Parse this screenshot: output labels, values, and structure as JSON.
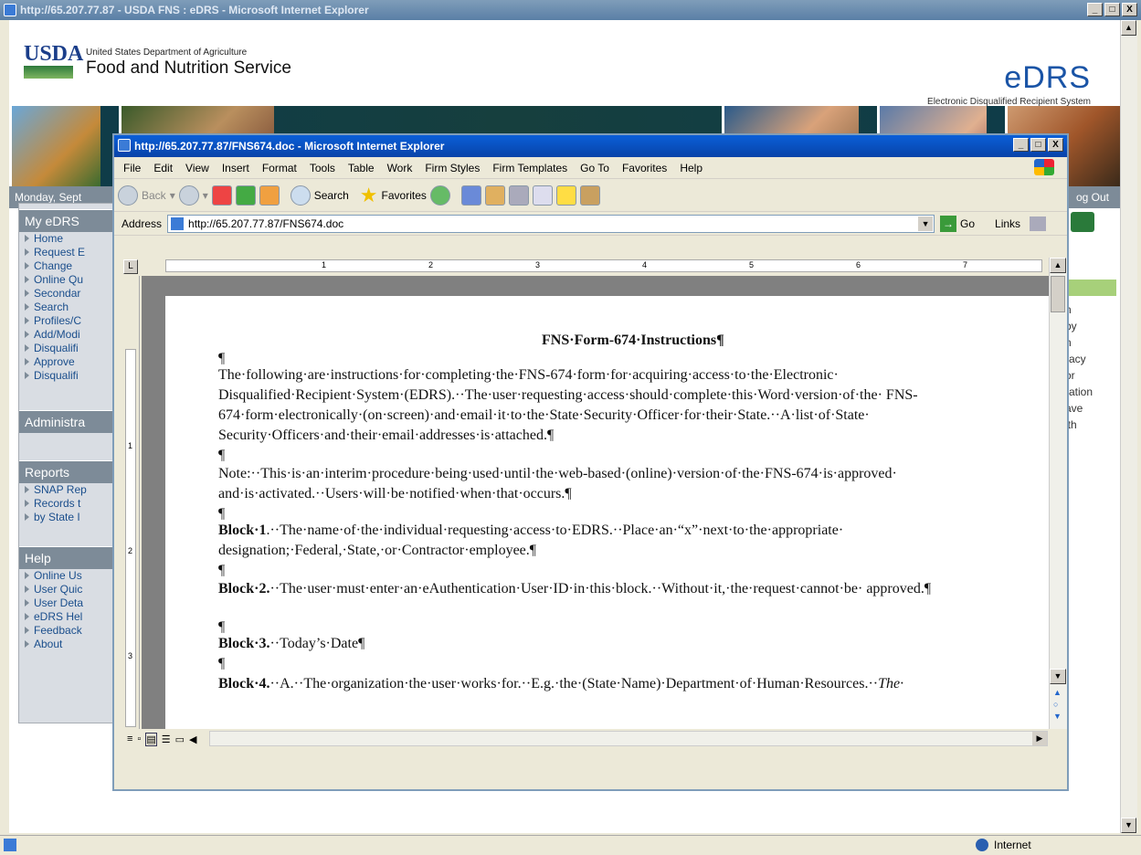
{
  "outer_window": {
    "title": "http://65.207.77.87 - USDA FNS : eDRS - Microsoft Internet Explorer"
  },
  "window_buttons": {
    "min": "_",
    "max": "□",
    "close": "X"
  },
  "header": {
    "usda": "USDA",
    "dept": "United States Department of Agriculture",
    "agency": "Food and Nutrition Service",
    "brand": "eDRS",
    "brand_sub": "Electronic Disqualified Recipient System"
  },
  "datebar": {
    "date": "Monday, Sept",
    "logout": "og Out"
  },
  "sidebar": {
    "my_edrs": "My eDRS",
    "my_items": [
      "Home",
      "Request E",
      "Change",
      "Online Qu",
      "Secondar",
      "Search",
      "Profiles/C",
      "Add/Modi",
      "Disqualifi",
      "Approve",
      "Disqualifi"
    ],
    "admin": "Administra",
    "reports": "Reports",
    "report_items": [
      "SNAP Rep",
      "Records t",
      "by State I"
    ],
    "help": "Help",
    "help_items": [
      "Online Us",
      "User Quic",
      "User Deta",
      "eDRS Hel",
      "Feedback",
      "About"
    ]
  },
  "right_panel": {
    "fragments": [
      "n",
      "by",
      "n",
      "racy",
      "or",
      "ration",
      "ave",
      "ith"
    ]
  },
  "inner_window": {
    "title": "http://65.207.77.87/FNS674.doc - Microsoft Internet Explorer"
  },
  "menu": [
    "File",
    "Edit",
    "View",
    "Insert",
    "Format",
    "Tools",
    "Table",
    "Work",
    "Firm Styles",
    "Firm Templates",
    "Go To",
    "Favorites",
    "Help"
  ],
  "toolbar": {
    "back": "Back",
    "search": "Search",
    "favorites": "Favorites"
  },
  "address": {
    "label": "Address",
    "url": "http://65.207.77.87/FNS674.doc",
    "go": "Go",
    "links": "Links"
  },
  "ruler": {
    "marks": [
      "1",
      "2",
      "3",
      "4",
      "5",
      "6",
      "7"
    ]
  },
  "vruler": {
    "marks": [
      "1",
      "2",
      "3"
    ]
  },
  "document": {
    "title": "FNS·Form-674·Instructions¶",
    "pilcrow": "¶",
    "p1": "The·following·are·instructions·for·completing·the·FNS-674·form·for·acquiring·access·to·the·Electronic· Disqualified·Recipient·System·(EDRS).··The·user·requesting·access·should·complete·this·Word·version·of·the· FNS-674·form·electronically·(on·screen)·and·email·it·to·the·State·Security·Officer·for·their·State.··A·list·of·State· Security·Officers·and·their·email·addresses·is·attached.¶",
    "p2": "Note:··This·is·an·interim·procedure·being·used·until·the·web-based·(online)·version·of·the·FNS-674·is·approved· and·is·activated.··Users·will·be·notified·when·that·occurs.¶",
    "b1_label": "Block·1",
    "b1_text": ".··The·name·of·the·individual·requesting·access·to·EDRS.··Place·an·“x”·next·to·the·appropriate· designation;·Federal,·State,·or·Contractor·employee.¶",
    "b2_label": "Block·2.",
    "b2_text": "··The·user·must·enter·an·eAuthentication·User·ID·in·this·block.··Without·it,·the·request·cannot·be· approved.¶",
    "b3_label": "Block·3.",
    "b3_text": "··Today’s·Date¶",
    "b4_label": "Block·4.",
    "b4_text": "··A.··The·organization·the·user·works·for.··E.g.·the·(State·Name)·Department·of·Human·Resources.··",
    "b4_italic": "The·"
  },
  "status": {
    "zone": "Internet"
  }
}
